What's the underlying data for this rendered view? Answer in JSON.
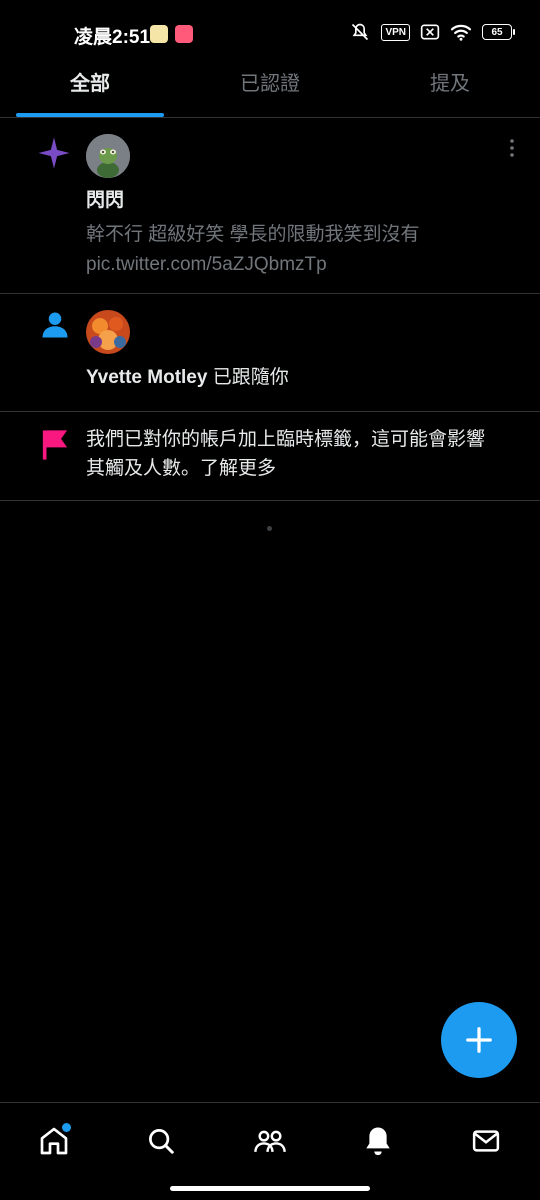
{
  "status_bar": {
    "time": "凌晨2:51",
    "vpn": "VPN",
    "battery": "65",
    "icons": [
      "app-notification-icon",
      "app-notification-icon",
      "mute-icon",
      "vpn-icon",
      "no-sim-icon",
      "wifi-icon",
      "battery-icon"
    ]
  },
  "tabs": [
    {
      "label": "全部",
      "active": true
    },
    {
      "label": "已認證",
      "active": false
    },
    {
      "label": "提及",
      "active": false
    }
  ],
  "notifications": [
    {
      "type": "recommended",
      "icon": "sparkle-icon",
      "user": "閃閃",
      "text": "幹不行 超級好笑 學長的限動我笑到沒有",
      "link": "pic.twitter.com/5aZJQbmzTp"
    },
    {
      "type": "follow",
      "icon": "person-icon",
      "user": "Yvette Motley",
      "action": " 已跟隨你"
    },
    {
      "type": "account-notice",
      "icon": "flag-icon",
      "line1": "我們已對你的帳戶加上臨時標籤，這可能會影響",
      "line2": "其觸及人數。了解更多"
    }
  ],
  "bottom_nav": [
    {
      "name": "home",
      "icon": "home-icon",
      "badge": true
    },
    {
      "name": "search",
      "icon": "search-icon",
      "badge": false
    },
    {
      "name": "communities",
      "icon": "communities-icon",
      "badge": false
    },
    {
      "name": "notifications",
      "icon": "bell-icon",
      "badge": false
    },
    {
      "name": "messages",
      "icon": "mail-icon",
      "badge": false
    }
  ],
  "colors": {
    "accent": "#1d9bf0",
    "sparkle": "#794bc4",
    "flag": "#f91880",
    "muted": "#71767b",
    "divider": "#2f3336"
  }
}
